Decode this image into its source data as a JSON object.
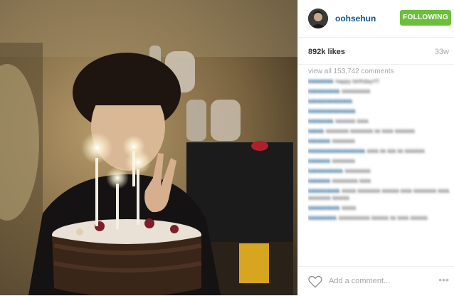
{
  "post": {
    "username": "oohsehun",
    "follow_label": "FOLLOWING",
    "likes": "892k likes",
    "age": "33w",
    "view_all": "view all 153,742 comments",
    "add_comment_placeholder": "Add a comment...",
    "more_label": "•••"
  },
  "comments": [
    {
      "user": "kkkkkkkk",
      "text": "happy birthday!!!!"
    },
    {
      "user": "kkkkkkkkkk",
      "text": "kkkkkkkkkk"
    },
    {
      "user": "kkkkkkkkkkkkkk",
      "text": ""
    },
    {
      "user": "kkkkkkkkkkkkkkk",
      "text": ""
    },
    {
      "user": "kkkkkkkk",
      "text": "kkkkkkk kkkk"
    },
    {
      "user": "kkkkk",
      "text": "kkkkkkkk kkkkkkkk kk kkkk kkkkkkk"
    },
    {
      "user": "kkkkkkk",
      "text": "kkkkkkkk"
    },
    {
      "user": "kkkkkkkkkkkkkkkkkk",
      "text": "kkkk kk kkk kk kkkkkkk"
    },
    {
      "user": "kkkkkkk",
      "text": "kkkkkkkk"
    },
    {
      "user": "kkkkkkkkkkk",
      "text": "kkkkkkkkk"
    },
    {
      "user": "kkkkkkk",
      "text": "kkkkkkkkk kkkk"
    },
    {
      "user": "kkkkkkkkkk",
      "text": "kkkkk kkkkkkkk kkkkkk kkkk kkkkkkkk kkkk kkkkkkkk kkkkkk"
    },
    {
      "user": "kkkkkkkkkk",
      "text": "kkkkk"
    },
    {
      "user": "kkkkkkkkk",
      "text": "kkkkkkkkkkk kkkkkk kk kkkk kkkkkk"
    }
  ]
}
